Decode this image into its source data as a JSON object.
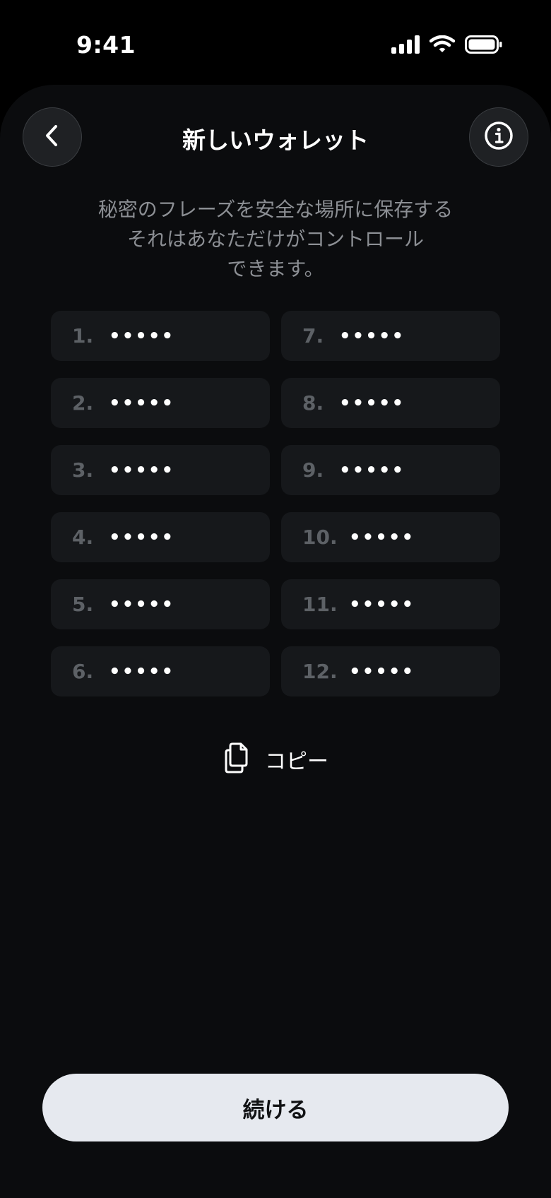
{
  "status_bar": {
    "time": "9:41"
  },
  "header": {
    "title": "新しいウォレット",
    "back_icon": "chevron-left-icon",
    "info_icon": "info-icon"
  },
  "subtitle": {
    "lines": [
      "秘密のフレーズを安全な場所に保存する",
      "それはあなただけがコントロール",
      "できます。"
    ]
  },
  "phrase": {
    "words": [
      {
        "number": "1.",
        "mask": "•••••"
      },
      {
        "number": "7.",
        "mask": "•••••"
      },
      {
        "number": "2.",
        "mask": "•••••"
      },
      {
        "number": "8.",
        "mask": "•••••"
      },
      {
        "number": "3.",
        "mask": "•••••"
      },
      {
        "number": "9.",
        "mask": "•••••"
      },
      {
        "number": "4.",
        "mask": "•••••"
      },
      {
        "number": "10.",
        "mask": "•••••"
      },
      {
        "number": "5.",
        "mask": "•••••"
      },
      {
        "number": "11.",
        "mask": "•••••"
      },
      {
        "number": "6.",
        "mask": "•••••"
      },
      {
        "number": "12.",
        "mask": "•••••"
      }
    ]
  },
  "copy": {
    "label": "コピー",
    "icon": "copy-icon"
  },
  "footer": {
    "continue_label": "続ける"
  },
  "colors": {
    "background": "#0b0c0e",
    "cell": "#16181b",
    "button_light": "#e6e9ef",
    "muted_text": "#8c8f94"
  }
}
